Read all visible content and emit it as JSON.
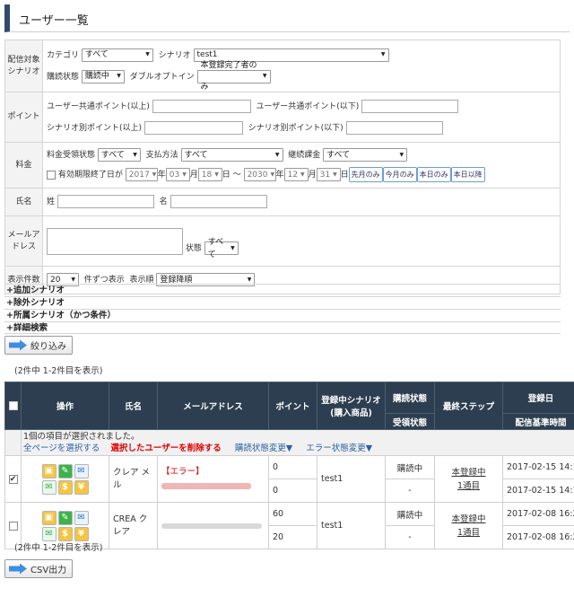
{
  "page_title": "ユーザー一覧",
  "form": {
    "target_label": "配信対象シナリオ",
    "category_label": "カテゴリ",
    "category_value": "すべて",
    "scenario_label": "シナリオ",
    "scenario_value": "test1",
    "subscribe_label": "購読状態",
    "subscribe_value": "購読中",
    "double_optin_label": "ダブルオプトイン",
    "double_optin_value": "本登録完了者のみ",
    "point_label": "ポイント",
    "common_min_label": "ユーザー共通ポイント(以上)",
    "common_max_label": "ユーザー共通ポイント(以下)",
    "scenario_min_label": "シナリオ別ポイント(以上)",
    "scenario_max_label": "シナリオ別ポイント(以下)",
    "fee_label": "料金",
    "fee_status_label": "料金受領状態",
    "fee_status_value": "すべて",
    "pay_method_label": "支払方法",
    "pay_method_value": "すべて",
    "recurring_label": "継続課金",
    "recurring_value": "すべて",
    "expiry_label": "有効期限終了日が",
    "from_year": "2017",
    "from_month": "03",
    "from_day": "18",
    "to_year": "2030",
    "to_month": "12",
    "to_day": "31",
    "year_unit": "年",
    "month_unit": "月",
    "day_unit": "日",
    "range_sep": "～",
    "btn_last_month": "先月のみ",
    "btn_this_month": "今月のみ",
    "btn_today": "本日のみ",
    "btn_after_today": "本日以降",
    "name_label": "氏名",
    "last_name_label": "姓",
    "first_name_label": "名",
    "mail_label": "メールアドレス",
    "mail_status_label": "状態",
    "mail_status_value": "すべて",
    "per_page_label": "表示件数",
    "per_page_value": "20",
    "per_page_suffix": "件ずつ表示",
    "order_label": "表示順",
    "order_value": "登録降順"
  },
  "accordions": [
    "+追加シナリオ",
    "+除外シナリオ",
    "+所属シナリオ（かつ条件）",
    "+詳細検索"
  ],
  "filter_button": "絞り込み",
  "count_text": "(2件中 1-2件目を表示)",
  "table": {
    "headers": {
      "ops": "操作",
      "name": "氏名",
      "mail": "メールアドレス",
      "point": "ポイント",
      "scenario": "登録中シナリオ",
      "scenario_sub": "(購入商品)",
      "subscribe": "購読状態",
      "receipt": "受領状態",
      "last_step": "最終ステップ",
      "reg_date": "登録日",
      "sched": "配信基準時間"
    },
    "selected_msg": "1個の項目が選択されました。",
    "select_all": "全ページを選択する",
    "delete_selected": "選択したユーザーを削除する",
    "change_sub": "購読状態変更▼",
    "change_err": "エラー状態変更▼",
    "rows": [
      {
        "name": "クレア メル",
        "error": "【エラー】",
        "point_common": "0",
        "point_scenario": "0",
        "scenario": "test1",
        "subscribe": "購読中",
        "receipt": "-",
        "last_step_a": "本登録中",
        "last_step_b": "1通目",
        "reg_date": "2017-02-15 14:1",
        "sched": "2017-02-15 14:1"
      },
      {
        "name": "CREA クレア",
        "point_common": "60",
        "point_scenario": "20",
        "scenario": "test1",
        "subscribe": "購読中",
        "receipt": "-",
        "last_step_a": "本登録中",
        "last_step_b": "1通目",
        "reg_date": "2017-02-08 16:2",
        "sched": "2017-02-08 16:2"
      }
    ]
  },
  "icons": {
    "mail": "✉",
    "yen": "¥",
    "dollar": "$",
    "edit": "✎"
  },
  "count_text_bottom": "(2件中 1-2件目を表示)",
  "csv_button": "CSV出力",
  "colors": {
    "header_bg": "#2d3e50",
    "accent_blue": "#3d8ee0",
    "error_red": "#d00000"
  }
}
